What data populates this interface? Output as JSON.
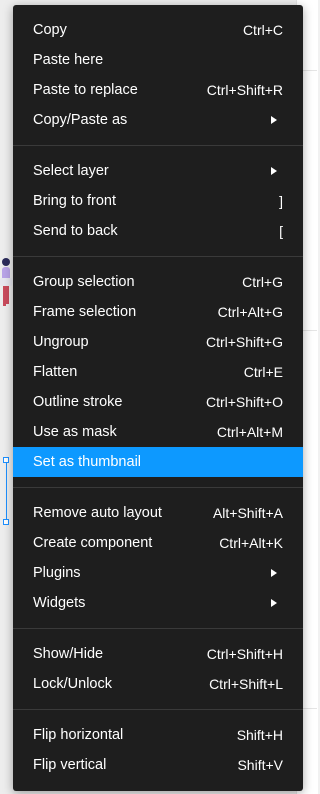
{
  "menu": {
    "group1": [
      {
        "label": "Copy",
        "shortcut": "Ctrl+C"
      },
      {
        "label": "Paste here",
        "shortcut": ""
      },
      {
        "label": "Paste to replace",
        "shortcut": "Ctrl+Shift+R"
      },
      {
        "label": "Copy/Paste as",
        "shortcut": "",
        "submenu": true
      }
    ],
    "group2": [
      {
        "label": "Select layer",
        "shortcut": "",
        "submenu": true
      },
      {
        "label": "Bring to front",
        "shortcut": "]"
      },
      {
        "label": "Send to back",
        "shortcut": "["
      }
    ],
    "group3": [
      {
        "label": "Group selection",
        "shortcut": "Ctrl+G"
      },
      {
        "label": "Frame selection",
        "shortcut": "Ctrl+Alt+G"
      },
      {
        "label": "Ungroup",
        "shortcut": "Ctrl+Shift+G"
      },
      {
        "label": "Flatten",
        "shortcut": "Ctrl+E"
      },
      {
        "label": "Outline stroke",
        "shortcut": "Ctrl+Shift+O"
      },
      {
        "label": "Use as mask",
        "shortcut": "Ctrl+Alt+M"
      },
      {
        "label": "Set as thumbnail",
        "shortcut": ""
      }
    ],
    "group4": [
      {
        "label": "Remove auto layout",
        "shortcut": "Alt+Shift+A"
      },
      {
        "label": "Create component",
        "shortcut": "Ctrl+Alt+K"
      },
      {
        "label": "Plugins",
        "shortcut": "",
        "submenu": true
      },
      {
        "label": "Widgets",
        "shortcut": "",
        "submenu": true
      }
    ],
    "group5": [
      {
        "label": "Show/Hide",
        "shortcut": "Ctrl+Shift+H"
      },
      {
        "label": "Lock/Unlock",
        "shortcut": "Ctrl+Shift+L"
      }
    ],
    "group6": [
      {
        "label": "Flip horizontal",
        "shortcut": "Shift+H"
      },
      {
        "label": "Flip vertical",
        "shortcut": "Shift+V"
      }
    ],
    "active_item": "Set as thumbnail",
    "submenu_icon": "chevron-right-icon"
  },
  "colors": {
    "menu_bg": "#1e1e1e",
    "highlight": "#0d99ff",
    "text": "#ffffff",
    "selection": "#1e90ff"
  }
}
